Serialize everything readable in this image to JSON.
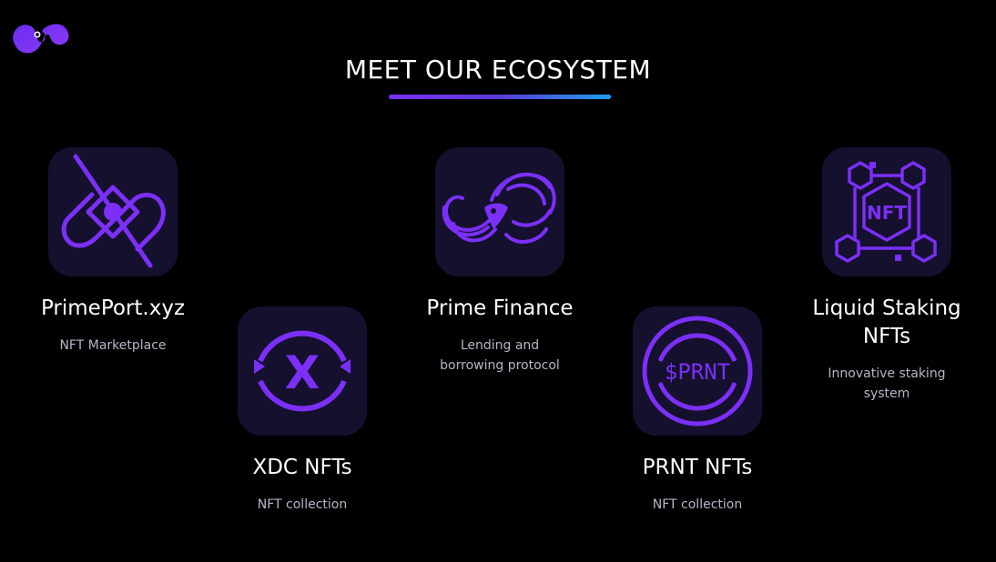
{
  "header": {
    "title": "MEET OUR ECOSYSTEM",
    "logo_icon": "brand-swirl-logo"
  },
  "colors": {
    "accent_purple": "#7b2ff7",
    "accent_blue": "#1aa1f0",
    "tile_bg": "#15102e",
    "page_bg": "#000000",
    "desc_text": "#b8b4c8"
  },
  "cards": [
    {
      "id": "primeport",
      "title": "PrimePort.xyz",
      "desc": "NFT Marketplace",
      "icon": "primeport-icon"
    },
    {
      "id": "xdc",
      "title": "XDC NFTs",
      "desc": "NFT collection",
      "icon": "xdc-icon",
      "icon_text": "X"
    },
    {
      "id": "primefinance",
      "title": "Prime Finance",
      "desc_line1": "Lending and",
      "desc_line2": "borrowing protocol",
      "icon": "prime-finance-icon"
    },
    {
      "id": "prnt",
      "title": "PRNT NFTs",
      "desc": "NFT collection",
      "icon": "prnt-icon",
      "icon_text": "$PRNT"
    },
    {
      "id": "liquid",
      "title_line1": "Liquid Staking",
      "title_line2": "NFTs",
      "desc_line1": "Innovative staking",
      "desc_line2": "system",
      "icon": "nft-cube-network-icon",
      "icon_text": "NFT"
    }
  ]
}
